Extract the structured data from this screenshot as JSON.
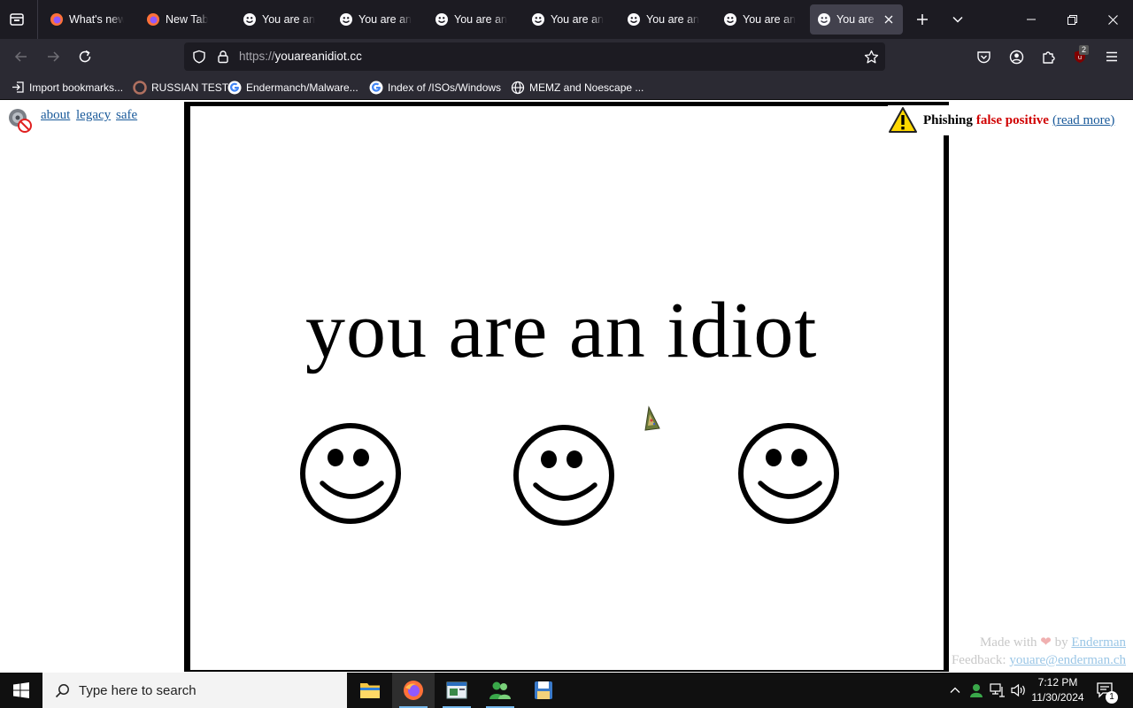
{
  "browser": {
    "tabs": [
      {
        "label": "What's new",
        "icon": "firefox-icon",
        "active": false
      },
      {
        "label": "New Tab",
        "icon": "firefox-icon",
        "active": false
      },
      {
        "label": "You are an idiot",
        "icon": "smiley-icon",
        "active": false
      },
      {
        "label": "You are an idiot",
        "icon": "smiley-icon",
        "active": false
      },
      {
        "label": "You are an idiot",
        "icon": "smiley-icon",
        "active": false
      },
      {
        "label": "You are an idiot",
        "icon": "smiley-icon",
        "active": false
      },
      {
        "label": "You are an idiot",
        "icon": "smiley-icon",
        "active": false
      },
      {
        "label": "You are an idiot",
        "icon": "smiley-icon",
        "active": false
      },
      {
        "label": "You are an idiot",
        "icon": "smiley-icon",
        "active": true
      }
    ],
    "url": {
      "scheme": "https://",
      "host": "youareanidiot.cc"
    },
    "extension_badge": "2",
    "bookmarks": [
      {
        "label": "Import bookmarks...",
        "icon": "import-icon"
      },
      {
        "label": "RUSSIAN TEST",
        "icon": "bookmark-favicon"
      },
      {
        "label": "Endermanch/Malware...",
        "icon": "google-icon"
      },
      {
        "label": "Index of /ISOs/Windows",
        "icon": "google-icon"
      },
      {
        "label": "MEMZ and Noescape ...",
        "icon": "globe-icon"
      }
    ]
  },
  "page": {
    "links": {
      "about": "about",
      "legacy": "legacy",
      "safe": "safe"
    },
    "headline": "you are an idiot",
    "phishing": {
      "label": "Phishing",
      "status": "false positive",
      "link": "(read more)"
    },
    "footer": {
      "made_prefix": "Made with",
      "made_by": "by",
      "author": "Enderman",
      "feedback_label": "Feedback:",
      "email": "youare@enderman.ch"
    }
  },
  "taskbar": {
    "search_placeholder": "Type here to search",
    "time": "7:12 PM",
    "date": "11/30/2024",
    "notification_count": "1"
  }
}
